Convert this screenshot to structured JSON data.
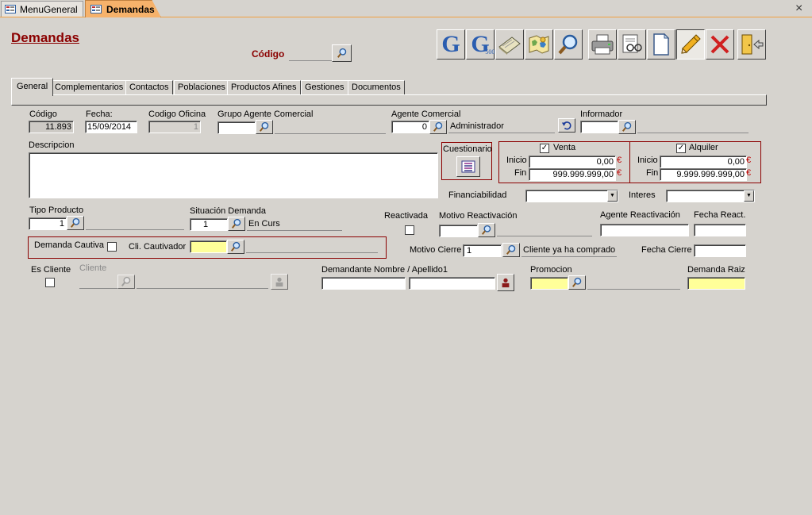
{
  "tabs_top": [
    {
      "label": "MenuGeneral"
    },
    {
      "label": "Demandas"
    }
  ],
  "close_glyph": "×",
  "form": {
    "title": "Demandas",
    "search_code_label": "Código",
    "toolbar": [
      "G",
      "G500",
      "notebook-icon",
      "world-map-icon",
      "magnifier-icon",
      "printer-icon",
      "preview-icon",
      "new-document-icon",
      "edit-pencil-icon",
      "delete-x-icon",
      "exit-door-icon"
    ],
    "g500_sub": "500"
  },
  "subtabs": [
    "General",
    "Complementarios",
    "Contactos",
    "Poblaciones",
    "Productos Afines",
    "Gestiones",
    "Documentos"
  ],
  "fields": {
    "codigo_label": "Código",
    "codigo_value": "11.893",
    "fecha_label": "Fecha:",
    "fecha_value": "15/09/2014",
    "oficina_label": "Codigo Oficina",
    "oficina_value": "1",
    "grupo_label": "Grupo Agente Comercial",
    "agente_label": "Agente Comercial",
    "agente_value": "0",
    "agente_name": "Administrador",
    "informador_label": "Informador",
    "descripcion_label": "Descripcion",
    "cuestionario_label": "Cuestionario",
    "venta_label": "Venta",
    "alquiler_label": "Alquiler",
    "inicio_label": "Inicio",
    "fin_label": "Fin",
    "venta_inicio": "0,00",
    "venta_fin": "999.999.999,00",
    "alq_inicio": "0,00",
    "alq_fin": "9.999.999.999,00",
    "euro": "€",
    "financiabilidad_label": "Financiabilidad",
    "interes_label": "Interes",
    "tipo_producto_label": "Tipo Producto",
    "tipo_producto_value": "1",
    "situacion_label": "Situación Demanda",
    "situacion_value": "1",
    "situacion_name": "En Curs",
    "reactivada_label": "Reactivada",
    "motivo_react_label": "Motivo Reactivación",
    "agente_react_label": "Agente Reactivación",
    "fecha_react_label": "Fecha React.",
    "demanda_cautiva_label": "Demanda Cautiva",
    "cli_cautivador_label": "Cli. Cautivador",
    "motivo_cierre_label": "Motivo Cierre",
    "motivo_cierre_value": "1",
    "motivo_cierre_name": "Cliente ya ha comprado",
    "fecha_cierre_label": "Fecha Cierre",
    "es_cliente_label": "Es Cliente",
    "cliente_label": "Cliente",
    "demandante_label": "Demandante Nombre / Apellido1",
    "promocion_label": "Promocion",
    "demanda_raiz_label": "Demanda Raiz"
  },
  "colors": {
    "accent_red": "#8b0000",
    "required_yellow": "#ffff99",
    "active_tab": "#f6b26b"
  }
}
